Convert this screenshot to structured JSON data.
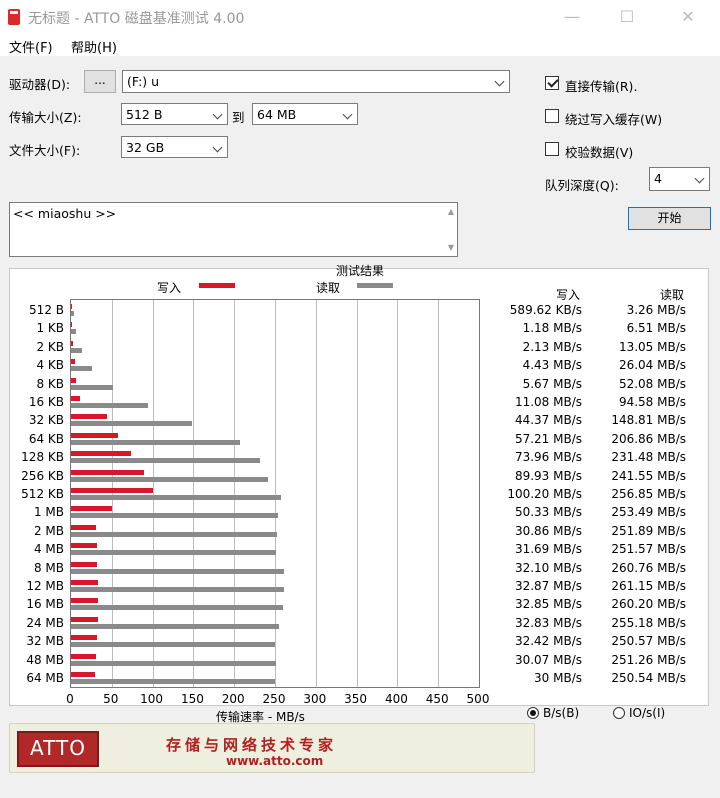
{
  "window": {
    "title": "无标题 - ATTO 磁盘基准测试 4.00",
    "minimize": "—",
    "maximize": "☐",
    "close": "✕"
  },
  "menu": [
    "文件(F)",
    "帮助(H)"
  ],
  "form": {
    "drive_label": "驱动器(D):",
    "browse_label": "...",
    "drive_value": "(F:) u",
    "transfer_label": "传输大小(Z):",
    "transfer_from": "512 B",
    "to_label": "到",
    "transfer_to": "64 MB",
    "filesize_label": "文件大小(F):",
    "filesize_value": "32 GB",
    "direct_io_label": "直接传输(R).",
    "direct_io_checked": true,
    "bypass_cache_label": "绕过写入缓存(W)",
    "bypass_cache_checked": false,
    "verify_label": "校验数据(V)",
    "verify_checked": false,
    "queue_label": "队列深度(Q):",
    "queue_value": "4",
    "start_label": "开始",
    "description": "<< miaoshu >>"
  },
  "results": {
    "title": "测试结果",
    "legend_write": "写入",
    "legend_read": "读取",
    "col_write": "写入",
    "col_read": "读取",
    "xlabel": "传输速率 - MB/s",
    "rows": [
      {
        "size": "512 B",
        "write": "589.62 KB/s",
        "read": "3.26 MB/s"
      },
      {
        "size": "1 KB",
        "write": "1.18 MB/s",
        "read": "6.51 MB/s"
      },
      {
        "size": "2 KB",
        "write": "2.13 MB/s",
        "read": "13.05 MB/s"
      },
      {
        "size": "4 KB",
        "write": "4.43 MB/s",
        "read": "26.04 MB/s"
      },
      {
        "size": "8 KB",
        "write": "5.67 MB/s",
        "read": "52.08 MB/s"
      },
      {
        "size": "16 KB",
        "write": "11.08 MB/s",
        "read": "94.58 MB/s"
      },
      {
        "size": "32 KB",
        "write": "44.37 MB/s",
        "read": "148.81 MB/s"
      },
      {
        "size": "64 KB",
        "write": "57.21 MB/s",
        "read": "206.86 MB/s"
      },
      {
        "size": "128 KB",
        "write": "73.96 MB/s",
        "read": "231.48 MB/s"
      },
      {
        "size": "256 KB",
        "write": "89.93 MB/s",
        "read": "241.55 MB/s"
      },
      {
        "size": "512 KB",
        "write": "100.20 MB/s",
        "read": "256.85 MB/s"
      },
      {
        "size": "1 MB",
        "write": "50.33 MB/s",
        "read": "253.49 MB/s"
      },
      {
        "size": "2 MB",
        "write": "30.86 MB/s",
        "read": "251.89 MB/s"
      },
      {
        "size": "4 MB",
        "write": "31.69 MB/s",
        "read": "251.57 MB/s"
      },
      {
        "size": "8 MB",
        "write": "32.10 MB/s",
        "read": "260.76 MB/s"
      },
      {
        "size": "12 MB",
        "write": "32.87 MB/s",
        "read": "261.15 MB/s"
      },
      {
        "size": "16 MB",
        "write": "32.85 MB/s",
        "read": "260.20 MB/s"
      },
      {
        "size": "24 MB",
        "write": "32.83 MB/s",
        "read": "255.18 MB/s"
      },
      {
        "size": "32 MB",
        "write": "32.42 MB/s",
        "read": "250.57 MB/s"
      },
      {
        "size": "48 MB",
        "write": "30.07 MB/s",
        "read": "251.26 MB/s"
      },
      {
        "size": "64 MB",
        "write": "30 MB/s",
        "read": "250.54 MB/s"
      }
    ],
    "unit_bytes_label": "B/s(B)",
    "unit_io_label": "IO/s(I)",
    "unit_selected": "B/s"
  },
  "chart_data": {
    "type": "bar",
    "orientation": "horizontal",
    "categories": [
      "512 B",
      "1 KB",
      "2 KB",
      "4 KB",
      "8 KB",
      "16 KB",
      "32 KB",
      "64 KB",
      "128 KB",
      "256 KB",
      "512 KB",
      "1 MB",
      "2 MB",
      "4 MB",
      "8 MB",
      "12 MB",
      "16 MB",
      "24 MB",
      "32 MB",
      "48 MB",
      "64 MB"
    ],
    "series": [
      {
        "name": "写入",
        "color": "#d8182a",
        "values": [
          0.58,
          1.18,
          2.13,
          4.43,
          5.67,
          11.08,
          44.37,
          57.21,
          73.96,
          89.93,
          100.2,
          50.33,
          30.86,
          31.69,
          32.1,
          32.87,
          32.85,
          32.83,
          32.42,
          30.07,
          30
        ]
      },
      {
        "name": "读取",
        "color": "#8a8a8a",
        "values": [
          3.26,
          6.51,
          13.05,
          26.04,
          52.08,
          94.58,
          148.81,
          206.86,
          231.48,
          241.55,
          256.85,
          253.49,
          251.89,
          251.57,
          260.76,
          261.15,
          260.2,
          255.18,
          250.57,
          251.26,
          250.54
        ]
      }
    ],
    "xlabel": "传输速率 - MB/s",
    "xlim": [
      0,
      500
    ],
    "xticks": [
      0,
      50,
      100,
      150,
      200,
      250,
      300,
      350,
      400,
      450,
      500
    ],
    "grid": true,
    "legend": "top"
  },
  "banner": {
    "logo": "ATTO",
    "slogan": "存储与网络技术专家",
    "url": "www.atto.com"
  }
}
